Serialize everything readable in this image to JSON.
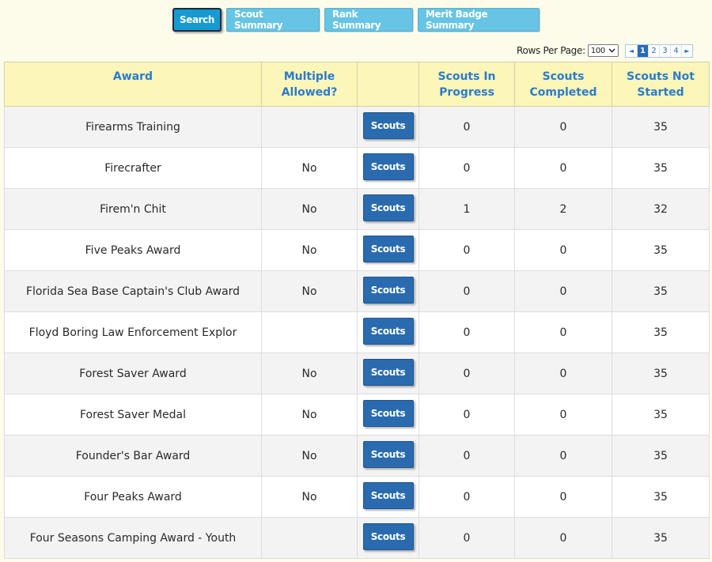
{
  "toolbar": {
    "buttons": [
      {
        "label": "Search"
      },
      {
        "label": "Scout Summary"
      },
      {
        "label": "Rank Summary"
      },
      {
        "label": "Merit Badge Summary"
      }
    ]
  },
  "pagination": {
    "rows_per_page_label": "Rows Per Page:",
    "rows_per_page_value": "100",
    "prev_icon": "◄",
    "next_icon": "►",
    "pages": [
      "1",
      "2",
      "3",
      "4"
    ],
    "current_page": "1"
  },
  "table": {
    "headers": {
      "award": "Award",
      "multiple": "Multiple Allowed?",
      "action": "",
      "in_progress": "Scouts In Progress",
      "completed": "Scouts Completed",
      "not_started": "Scouts Not Started"
    },
    "button_label": "Scouts",
    "rows": [
      {
        "award": "Firearms Training",
        "multiple": "",
        "in_progress": "0",
        "completed": "0",
        "not_started": "35"
      },
      {
        "award": "Firecrafter",
        "multiple": "No",
        "in_progress": "0",
        "completed": "0",
        "not_started": "35"
      },
      {
        "award": "Firem'n Chit",
        "multiple": "No",
        "in_progress": "1",
        "completed": "2",
        "not_started": "32"
      },
      {
        "award": "Five Peaks Award",
        "multiple": "No",
        "in_progress": "0",
        "completed": "0",
        "not_started": "35"
      },
      {
        "award": "Florida Sea Base Captain's Club Award",
        "multiple": "No",
        "in_progress": "0",
        "completed": "0",
        "not_started": "35"
      },
      {
        "award": "Floyd Boring Law Enforcement Explor",
        "multiple": "",
        "in_progress": "0",
        "completed": "0",
        "not_started": "35"
      },
      {
        "award": "Forest Saver Award",
        "multiple": "No",
        "in_progress": "0",
        "completed": "0",
        "not_started": "35"
      },
      {
        "award": "Forest Saver Medal",
        "multiple": "No",
        "in_progress": "0",
        "completed": "0",
        "not_started": "35"
      },
      {
        "award": "Founder's Bar Award",
        "multiple": "No",
        "in_progress": "0",
        "completed": "0",
        "not_started": "35"
      },
      {
        "award": "Four Peaks Award",
        "multiple": "No",
        "in_progress": "0",
        "completed": "0",
        "not_started": "35"
      },
      {
        "award": "Four Seasons Camping Award - Youth",
        "multiple": "",
        "in_progress": "0",
        "completed": "0",
        "not_started": "35"
      }
    ]
  }
}
